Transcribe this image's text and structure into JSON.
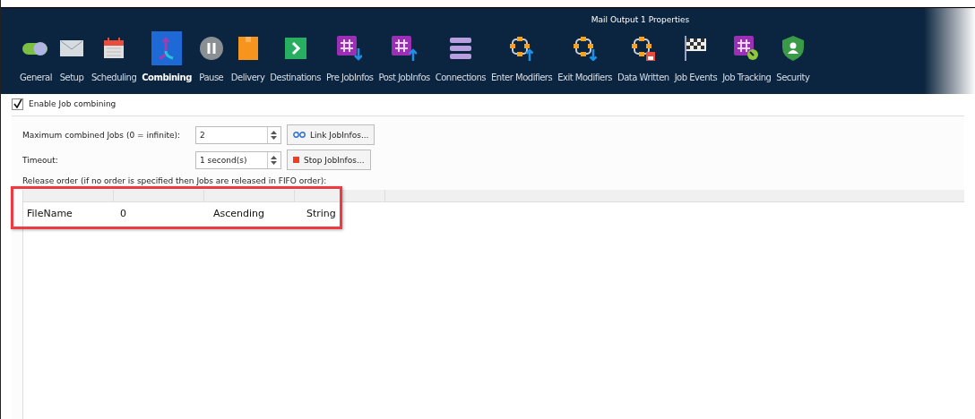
{
  "window": {
    "title": "Mail Output 1 Properties"
  },
  "tabs": [
    {
      "label": "General",
      "selected": false
    },
    {
      "label": "Setup",
      "selected": false
    },
    {
      "label": "Scheduling",
      "selected": false
    },
    {
      "label": "Combining",
      "selected": true
    },
    {
      "label": "Pause",
      "selected": false
    },
    {
      "label": "Delivery",
      "selected": false
    },
    {
      "label": "Destinations",
      "selected": false
    },
    {
      "label": "Pre JobInfos",
      "selected": false
    },
    {
      "label": "Post JobInfos",
      "selected": false
    },
    {
      "label": "Connections",
      "selected": false
    },
    {
      "label": "Enter Modifiers",
      "selected": false
    },
    {
      "label": "Exit Modifiers",
      "selected": false
    },
    {
      "label": "Data Written",
      "selected": false
    },
    {
      "label": "Job Events",
      "selected": false
    },
    {
      "label": "Job Tracking",
      "selected": false
    },
    {
      "label": "Security",
      "selected": false
    }
  ],
  "enable": {
    "label": "Enable Job combining",
    "checked": true
  },
  "max_jobs": {
    "label": "Maximum combined Jobs (0 = infinite):",
    "value": "2",
    "button": "Link JobInfos..."
  },
  "timeout": {
    "label": "Timeout:",
    "value": "1 second(s)",
    "button": "Stop JobInfos..."
  },
  "release_caption": "Release order (if no order is specified then Jobs are released in FIFO order):",
  "table": {
    "rows": [
      {
        "cells": [
          "FileName",
          "0",
          "Ascending",
          "String"
        ],
        "highlighted": true
      }
    ]
  }
}
